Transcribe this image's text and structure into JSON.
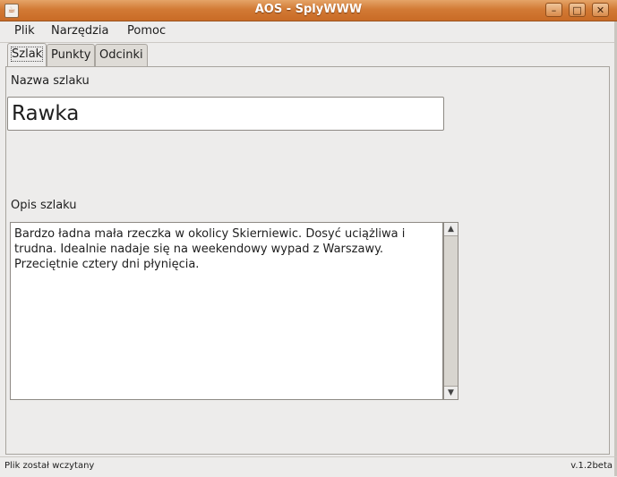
{
  "window": {
    "title": "AOS - SplyWWW",
    "icon": "java-cup-icon",
    "minimize_glyph": "–",
    "maximize_glyph": "□",
    "close_glyph": "✕"
  },
  "menu": {
    "items": [
      "Plik",
      "Narzędzia",
      "Pomoc"
    ]
  },
  "tabs": [
    {
      "label": "Szlak",
      "active": true
    },
    {
      "label": "Punkty",
      "active": false
    },
    {
      "label": "Odcinki",
      "active": false
    }
  ],
  "form": {
    "name_label": "Nazwa szlaku",
    "name_value": "Rawka",
    "description_label": "Opis szlaku",
    "description_value": "Bardzo ładna mała rzeczka w okolicy Skierniewic. Dosyć uciążliwa i\ntrudna. Idealnie nadaje się na weekendowy wypad z Warszawy.\nPrzeciętnie cztery dni płynięcia."
  },
  "status": {
    "message": "Plik został wczytany",
    "version": "v.1.2beta"
  },
  "colors": {
    "titlebar": "#d27a35",
    "background": "#edeceb"
  }
}
